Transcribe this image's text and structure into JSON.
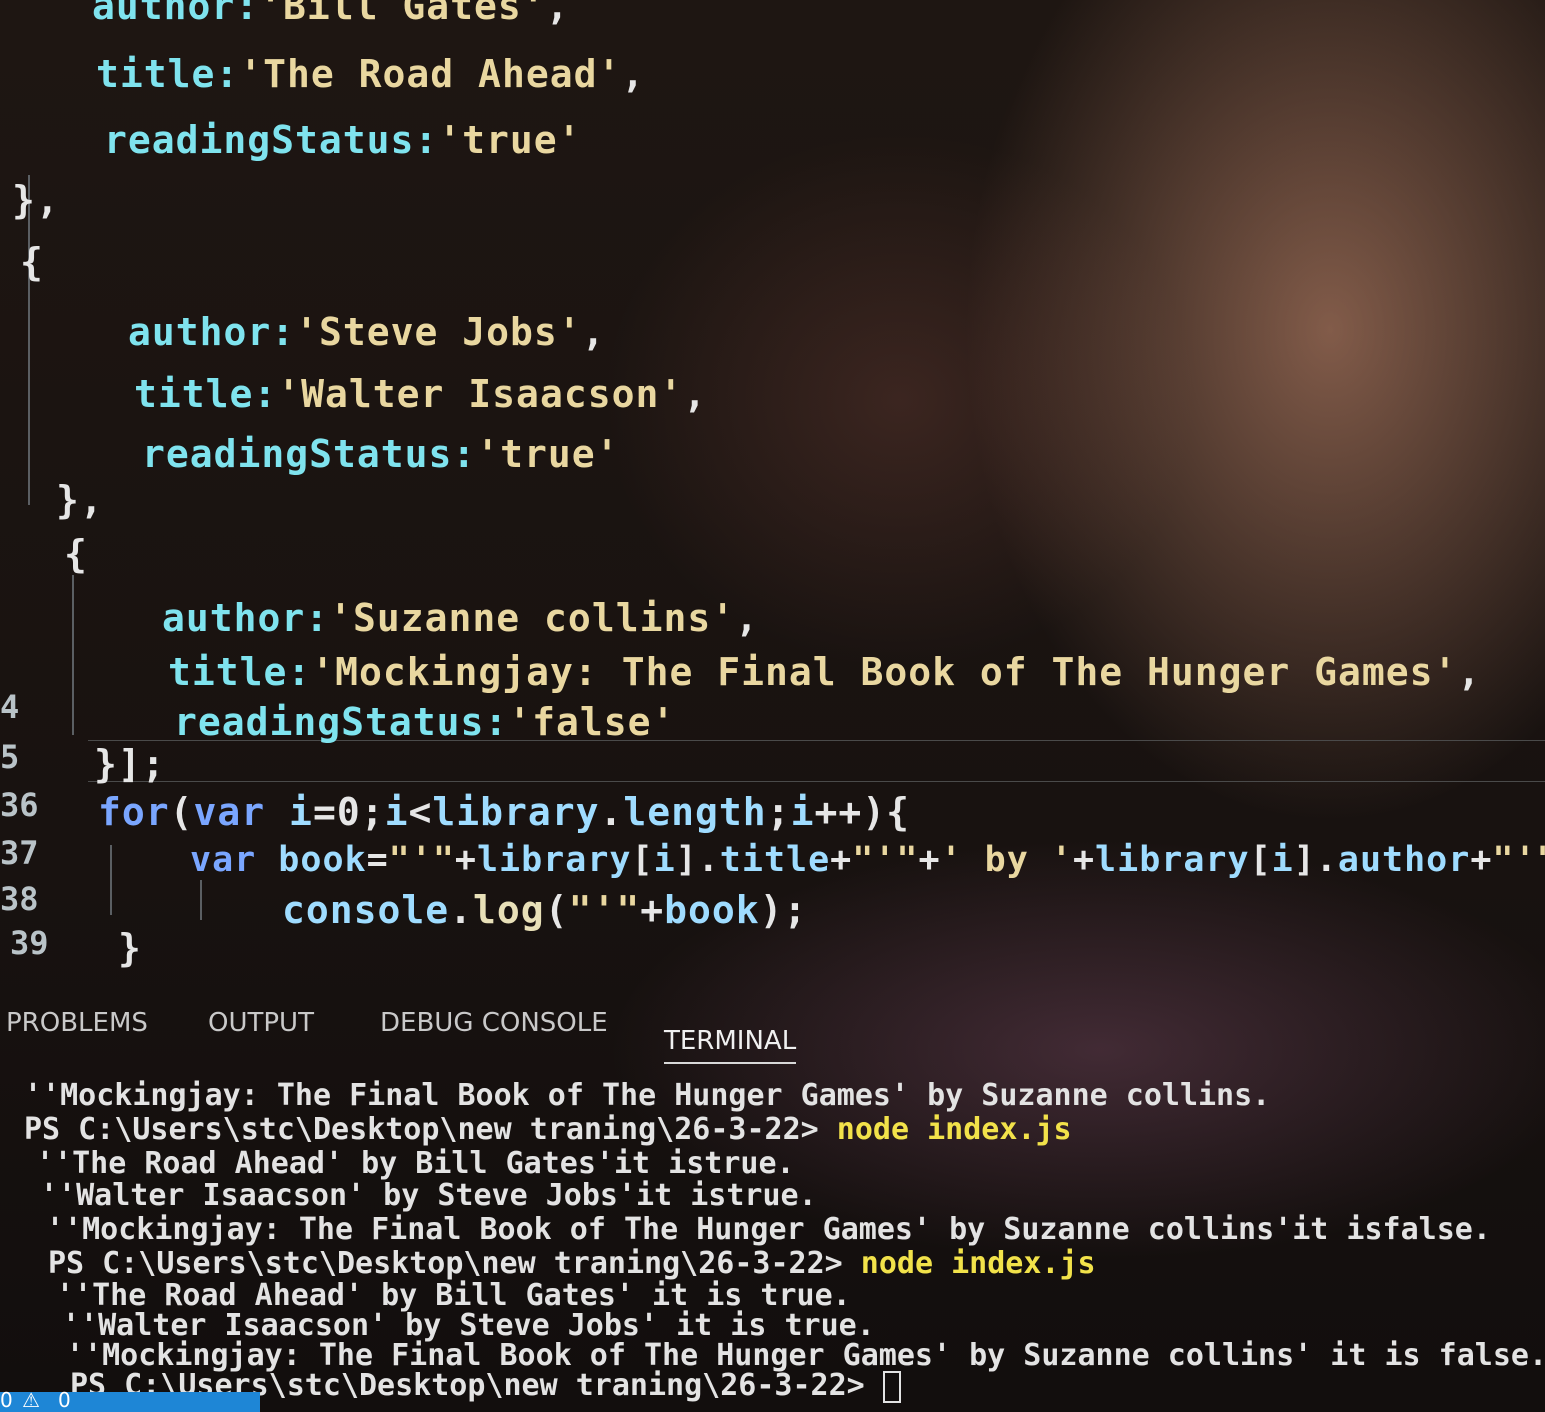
{
  "gutter": [
    "4",
    "5",
    "36",
    "37",
    "38",
    "39"
  ],
  "code": {
    "l1": [
      [
        "k",
        "author:"
      ],
      [
        "s",
        "'Bill Gates'"
      ],
      [
        "p",
        ","
      ]
    ],
    "l2": [
      [
        "k",
        "title:"
      ],
      [
        "s",
        "'The Road Ahead'"
      ],
      [
        "p",
        ","
      ]
    ],
    "l3": [
      [
        "k",
        "readingStatus:"
      ],
      [
        "s",
        "'true'"
      ]
    ],
    "l4": [
      [
        "p",
        "},"
      ]
    ],
    "l5": [
      [
        "p",
        "{"
      ]
    ],
    "l6": [
      [
        "k",
        "author:"
      ],
      [
        "s",
        "'Steve Jobs'"
      ],
      [
        "p",
        ","
      ]
    ],
    "l7": [
      [
        "k",
        "title:"
      ],
      [
        "s",
        "'Walter Isaacson'"
      ],
      [
        "p",
        ","
      ]
    ],
    "l8": [
      [
        "k",
        "readingStatus:"
      ],
      [
        "s",
        "'true'"
      ]
    ],
    "l9": [
      [
        "p",
        "},"
      ]
    ],
    "l10": [
      [
        "p",
        "{"
      ]
    ],
    "l11": [
      [
        "k",
        "author:"
      ],
      [
        "s",
        "'Suzanne collins'"
      ],
      [
        "p",
        ","
      ]
    ],
    "l12": [
      [
        "k",
        "title:"
      ],
      [
        "s",
        "'Mockingjay: The Final Book of The Hunger Games'"
      ],
      [
        "p",
        ","
      ]
    ],
    "l13": [
      [
        "k",
        "readingStatus:"
      ],
      [
        "s",
        "'false'"
      ]
    ],
    "l14": [
      [
        "p",
        "}];"
      ]
    ],
    "l15": [
      [
        "kw",
        "for"
      ],
      [
        "p",
        "("
      ],
      [
        "kw",
        "var "
      ],
      [
        "v",
        "i"
      ],
      [
        "p",
        "=0;"
      ],
      [
        "v",
        "i"
      ],
      [
        "p",
        "<"
      ],
      [
        "v",
        "library"
      ],
      [
        "p",
        "."
      ],
      [
        "v",
        "length"
      ],
      [
        "p",
        ";"
      ],
      [
        "v",
        "i"
      ],
      [
        "p",
        "++){"
      ]
    ],
    "l16": [
      [
        "kw",
        "var "
      ],
      [
        "v",
        "book"
      ],
      [
        "p",
        "="
      ],
      [
        "s",
        "\"'\""
      ],
      [
        "p",
        "+"
      ],
      [
        "v",
        "library"
      ],
      [
        "p",
        "["
      ],
      [
        "v",
        "i"
      ],
      [
        "p",
        "]."
      ],
      [
        "v",
        "title"
      ],
      [
        "p",
        "+"
      ],
      [
        "s",
        "\"'\""
      ],
      [
        "p",
        "+"
      ],
      [
        "s",
        "' by '"
      ],
      [
        "p",
        "+"
      ],
      [
        "v",
        "library"
      ],
      [
        "p",
        "["
      ],
      [
        "v",
        "i"
      ],
      [
        "p",
        "]."
      ],
      [
        "v",
        "author"
      ],
      [
        "p",
        "+"
      ],
      [
        "s",
        "\"'\""
      ],
      [
        "p",
        "+'"
      ]
    ],
    "l17": [
      [
        "v",
        "console"
      ],
      [
        "p",
        "."
      ],
      [
        "f",
        "log"
      ],
      [
        "p",
        "("
      ],
      [
        "s",
        "\"'\""
      ],
      [
        "p",
        "+"
      ],
      [
        "v",
        "book"
      ],
      [
        "p",
        ");"
      ]
    ],
    "l18": [
      [
        "p",
        "}"
      ]
    ]
  },
  "panel_tabs": [
    "PROBLEMS",
    "OUTPUT",
    "DEBUG CONSOLE",
    "TERMINAL"
  ],
  "terminal": [
    {
      "text": "''Mockingjay: The Final Book of The Hunger Games' by Suzanne collins."
    },
    {
      "text": "PS C:\\Users\\stc\\Desktop\\new traning\\26-3-22> ",
      "cmd": "node index.js"
    },
    {
      "text": "''The Road Ahead' by Bill Gates'it istrue."
    },
    {
      "text": "''Walter Isaacson' by Steve Jobs'it istrue."
    },
    {
      "text": "''Mockingjay: The Final Book of The Hunger Games' by Suzanne collins'it isfalse."
    },
    {
      "text": "PS C:\\Users\\stc\\Desktop\\new traning\\26-3-22> ",
      "cmd": "node index.js"
    },
    {
      "text": "''The Road Ahead' by Bill Gates' it is true."
    },
    {
      "text": "''Walter Isaacson' by Steve Jobs' it is true."
    },
    {
      "text": "''Mockingjay: The Final Book of The Hunger Games' by Suzanne collins' it is false."
    },
    {
      "text": "PS C:\\Users\\stc\\Desktop\\new traning\\26-3-22> ",
      "cursor": true
    }
  ],
  "status": {
    "errors": "0",
    "warnings": "0"
  },
  "colors": {
    "status_bar": "#1e86d6",
    "terminal_cmd": "#f2e24a",
    "keys": "#7fe3ee",
    "strings": "#e9d7a0"
  }
}
